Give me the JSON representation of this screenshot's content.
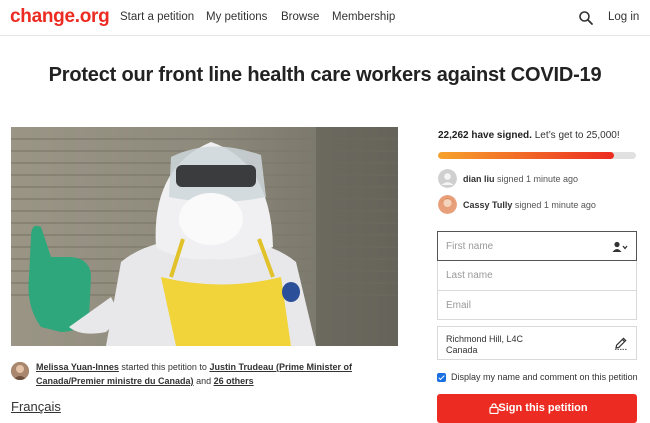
{
  "header": {
    "logo": "change.org",
    "nav": [
      "Start a petition",
      "My petitions",
      "Browse",
      "Membership"
    ],
    "login": "Log in",
    "brand_color": "#ec2c22"
  },
  "petition": {
    "title": "Protect our front line health care workers against COVID-19",
    "starter": {
      "name": "Melissa Yuan-Innes",
      "mid1": " started this petition to ",
      "recipient": "Justin Trudeau (Prime Minister of Canada/Premier ministre du Canada)",
      "mid2": " and ",
      "others": "26 others"
    },
    "language_link": "Français"
  },
  "sign_panel": {
    "count_bold": "22,262 have signed.",
    "count_rest": " Let’s get to 25,000!",
    "progress": 0.89,
    "recent_signers": [
      {
        "name": "dian liu",
        "action": " signed 1 minute ago"
      },
      {
        "name": "Cassy Tully",
        "action": " signed 1 minute ago"
      }
    ],
    "fields": {
      "first_name": "First name",
      "last_name": "Last name",
      "email": "Email"
    },
    "location_line1": "Richmond Hill, L4C",
    "location_line2": "Canada",
    "checkbox_label": "Display my name and comment on this petition",
    "sign_button": "Sign this petition"
  }
}
